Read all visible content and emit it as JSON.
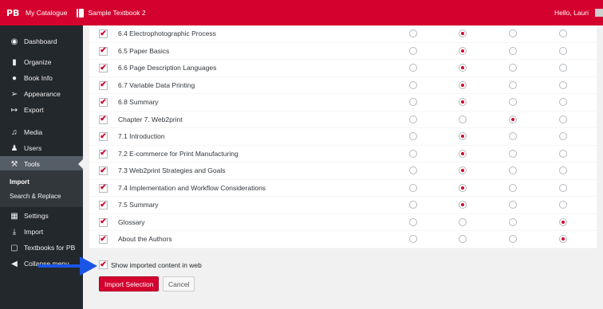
{
  "topbar": {
    "logo": "PB",
    "catalogue": "My Catalogue",
    "book": "Sample Textbook 2",
    "greeting": "Hello, Lauri"
  },
  "sidebar": {
    "items": [
      {
        "label": "Dashboard",
        "icon": "dashboard-icon"
      },
      {
        "label": "Organize",
        "icon": "organize-icon"
      },
      {
        "label": "Book Info",
        "icon": "info-icon"
      },
      {
        "label": "Appearance",
        "icon": "appearance-icon"
      },
      {
        "label": "Export",
        "icon": "export-icon"
      },
      {
        "label": "Media",
        "icon": "media-icon"
      },
      {
        "label": "Users",
        "icon": "users-icon"
      },
      {
        "label": "Tools",
        "icon": "wrench-icon"
      },
      {
        "label": "Settings",
        "icon": "settings-icon"
      },
      {
        "label": "Import",
        "icon": "import-icon"
      },
      {
        "label": "Textbooks for PB",
        "icon": "textbooks-icon"
      },
      {
        "label": "Collapse menu",
        "icon": "collapse-icon"
      }
    ],
    "submenu": [
      "Import",
      "Search & Replace"
    ]
  },
  "rows": [
    {
      "title": "6.4 Electrophotographic Process",
      "checked": true,
      "selected": 1
    },
    {
      "title": "6.5 Paper Basics",
      "checked": true,
      "selected": 1
    },
    {
      "title": "6.6 Page Description Languages",
      "checked": true,
      "selected": 1
    },
    {
      "title": "6.7 Variable Data Printing",
      "checked": true,
      "selected": 1
    },
    {
      "title": "6.8 Summary",
      "checked": true,
      "selected": 1
    },
    {
      "title": "Chapter 7. Web2print",
      "checked": true,
      "selected": 2
    },
    {
      "title": "7.1 Introduction",
      "checked": true,
      "selected": 1
    },
    {
      "title": "7.2 E-commerce for Print Manufacturing",
      "checked": true,
      "selected": 1
    },
    {
      "title": "7.3 Web2print Strategies and Goals",
      "checked": true,
      "selected": 1
    },
    {
      "title": "7.4 Implementation and Workflow Considerations",
      "checked": true,
      "selected": 1
    },
    {
      "title": "7.5 Summary",
      "checked": true,
      "selected": 1
    },
    {
      "title": "Glossary",
      "checked": true,
      "selected": 3
    },
    {
      "title": "About the Authors",
      "checked": true,
      "selected": 3
    }
  ],
  "footer": {
    "show_label": "Show imported content in web",
    "show_checked": true,
    "import_button": "Import Selection",
    "cancel_button": "Cancel"
  },
  "colors": {
    "accent": "#d4002e",
    "sidebar": "#23282d",
    "annotation_arrow": "#1a55e6"
  }
}
